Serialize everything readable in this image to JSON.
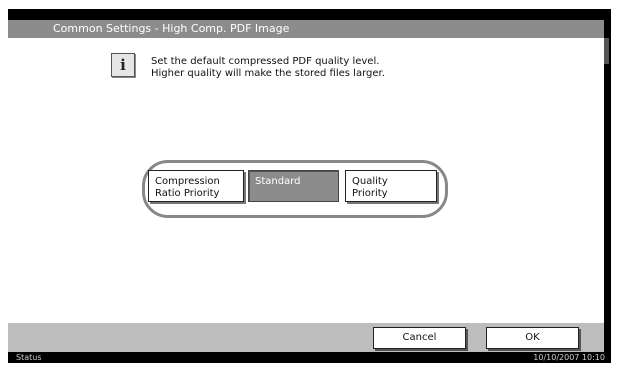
{
  "title": "Common Settings - High Comp. PDF Image",
  "info": {
    "icon": "info-icon",
    "line1": "Set the default compressed PDF quality level.",
    "line2": "Higher quality will make the stored files larger."
  },
  "options": {
    "compression": {
      "line1": "Compression",
      "line2": "Ratio Priority"
    },
    "standard": {
      "label": "Standard",
      "selected": true
    },
    "quality": {
      "line1": "Quality",
      "line2": "Priority"
    }
  },
  "buttons": {
    "cancel": "Cancel",
    "ok": "OK"
  },
  "status": {
    "label": "Status",
    "datetime": "10/10/2007   10:10"
  },
  "colors": {
    "titlebar": "#8c8c8c",
    "selected": "#8c8c8c",
    "bottombar": "#bdbdbd",
    "frame": "#000000"
  }
}
